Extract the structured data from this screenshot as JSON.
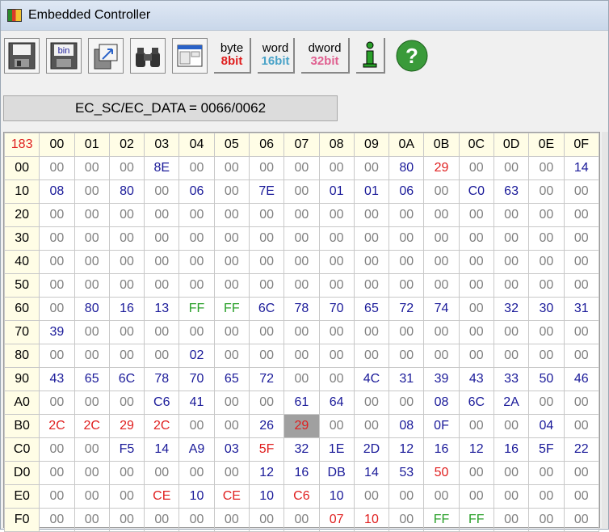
{
  "window": {
    "title": "Embedded Controller"
  },
  "toolbar": {
    "buttons": [
      {
        "name": "save-icon"
      },
      {
        "name": "save-bin-icon",
        "label": "bin"
      },
      {
        "name": "load-icon"
      },
      {
        "name": "search-binoculars-icon"
      },
      {
        "name": "window-icon"
      }
    ],
    "byte_top": "byte",
    "byte_bot": "8bit",
    "word_top": "word",
    "word_bot": "16bit",
    "dword_top": "dword",
    "dword_bot": "32bit",
    "info_label": "i",
    "help_label": "?"
  },
  "status": {
    "text": "EC_SC/EC_DATA = 0066/0062"
  },
  "colors": {
    "zero": "#808080",
    "value": "#1a1a99",
    "high": "#e02020",
    "ff": "#2aa02a"
  },
  "table": {
    "corner": "183",
    "columns": [
      "00",
      "01",
      "02",
      "03",
      "04",
      "05",
      "06",
      "07",
      "08",
      "09",
      "0A",
      "0B",
      "0C",
      "0D",
      "0E",
      "0F"
    ],
    "rows": [
      {
        "label": "00",
        "cells": [
          "00",
          "00",
          "00",
          "8E",
          "00",
          "00",
          "00",
          "00",
          "00",
          "00",
          "80",
          "29",
          "00",
          "00",
          "00",
          "14"
        ]
      },
      {
        "label": "10",
        "cells": [
          "08",
          "00",
          "80",
          "00",
          "06",
          "00",
          "7E",
          "00",
          "01",
          "01",
          "06",
          "00",
          "C0",
          "63",
          "00",
          "00"
        ]
      },
      {
        "label": "20",
        "cells": [
          "00",
          "00",
          "00",
          "00",
          "00",
          "00",
          "00",
          "00",
          "00",
          "00",
          "00",
          "00",
          "00",
          "00",
          "00",
          "00"
        ]
      },
      {
        "label": "30",
        "cells": [
          "00",
          "00",
          "00",
          "00",
          "00",
          "00",
          "00",
          "00",
          "00",
          "00",
          "00",
          "00",
          "00",
          "00",
          "00",
          "00"
        ]
      },
      {
        "label": "40",
        "cells": [
          "00",
          "00",
          "00",
          "00",
          "00",
          "00",
          "00",
          "00",
          "00",
          "00",
          "00",
          "00",
          "00",
          "00",
          "00",
          "00"
        ]
      },
      {
        "label": "50",
        "cells": [
          "00",
          "00",
          "00",
          "00",
          "00",
          "00",
          "00",
          "00",
          "00",
          "00",
          "00",
          "00",
          "00",
          "00",
          "00",
          "00"
        ]
      },
      {
        "label": "60",
        "cells": [
          "00",
          "80",
          "16",
          "13",
          "FF",
          "FF",
          "6C",
          "78",
          "70",
          "65",
          "72",
          "74",
          "00",
          "32",
          "30",
          "31"
        ]
      },
      {
        "label": "70",
        "cells": [
          "39",
          "00",
          "00",
          "00",
          "00",
          "00",
          "00",
          "00",
          "00",
          "00",
          "00",
          "00",
          "00",
          "00",
          "00",
          "00"
        ]
      },
      {
        "label": "80",
        "cells": [
          "00",
          "00",
          "00",
          "00",
          "02",
          "00",
          "00",
          "00",
          "00",
          "00",
          "00",
          "00",
          "00",
          "00",
          "00",
          "00"
        ]
      },
      {
        "label": "90",
        "cells": [
          "43",
          "65",
          "6C",
          "78",
          "70",
          "65",
          "72",
          "00",
          "00",
          "4C",
          "31",
          "39",
          "43",
          "33",
          "50",
          "46"
        ]
      },
      {
        "label": "A0",
        "cells": [
          "00",
          "00",
          "00",
          "C6",
          "41",
          "00",
          "00",
          "61",
          "64",
          "00",
          "00",
          "08",
          "6C",
          "2A",
          "00",
          "00"
        ]
      },
      {
        "label": "B0",
        "cells": [
          "2C",
          "2C",
          "29",
          "2C",
          "00",
          "00",
          "26",
          "29",
          "00",
          "00",
          "08",
          "0F",
          "00",
          "00",
          "04",
          "00"
        ]
      },
      {
        "label": "C0",
        "cells": [
          "00",
          "00",
          "F5",
          "14",
          "A9",
          "03",
          "5F",
          "32",
          "1E",
          "2D",
          "12",
          "16",
          "12",
          "16",
          "5F",
          "22"
        ]
      },
      {
        "label": "D0",
        "cells": [
          "00",
          "00",
          "00",
          "00",
          "00",
          "00",
          "12",
          "16",
          "DB",
          "14",
          "53",
          "50",
          "00",
          "00",
          "00",
          "00"
        ]
      },
      {
        "label": "E0",
        "cells": [
          "00",
          "00",
          "00",
          "CE",
          "10",
          "CE",
          "10",
          "C6",
          "10",
          "00",
          "00",
          "00",
          "00",
          "00",
          "00",
          "00"
        ]
      },
      {
        "label": "F0",
        "cells": [
          "00",
          "00",
          "00",
          "00",
          "00",
          "00",
          "00",
          "00",
          "07",
          "10",
          "00",
          "FF",
          "FF",
          "00",
          "00",
          "00"
        ]
      }
    ],
    "red_cells": [
      "0B:00",
      "B0:00",
      "B1:00",
      "B2:00",
      "B3:00",
      "B7:00",
      "C6:00",
      "CE:00",
      "E3:00",
      "E5:00",
      "E7:00",
      "F8:00",
      "F9:00",
      "DB:00"
    ],
    "selected_cell": "B7"
  }
}
